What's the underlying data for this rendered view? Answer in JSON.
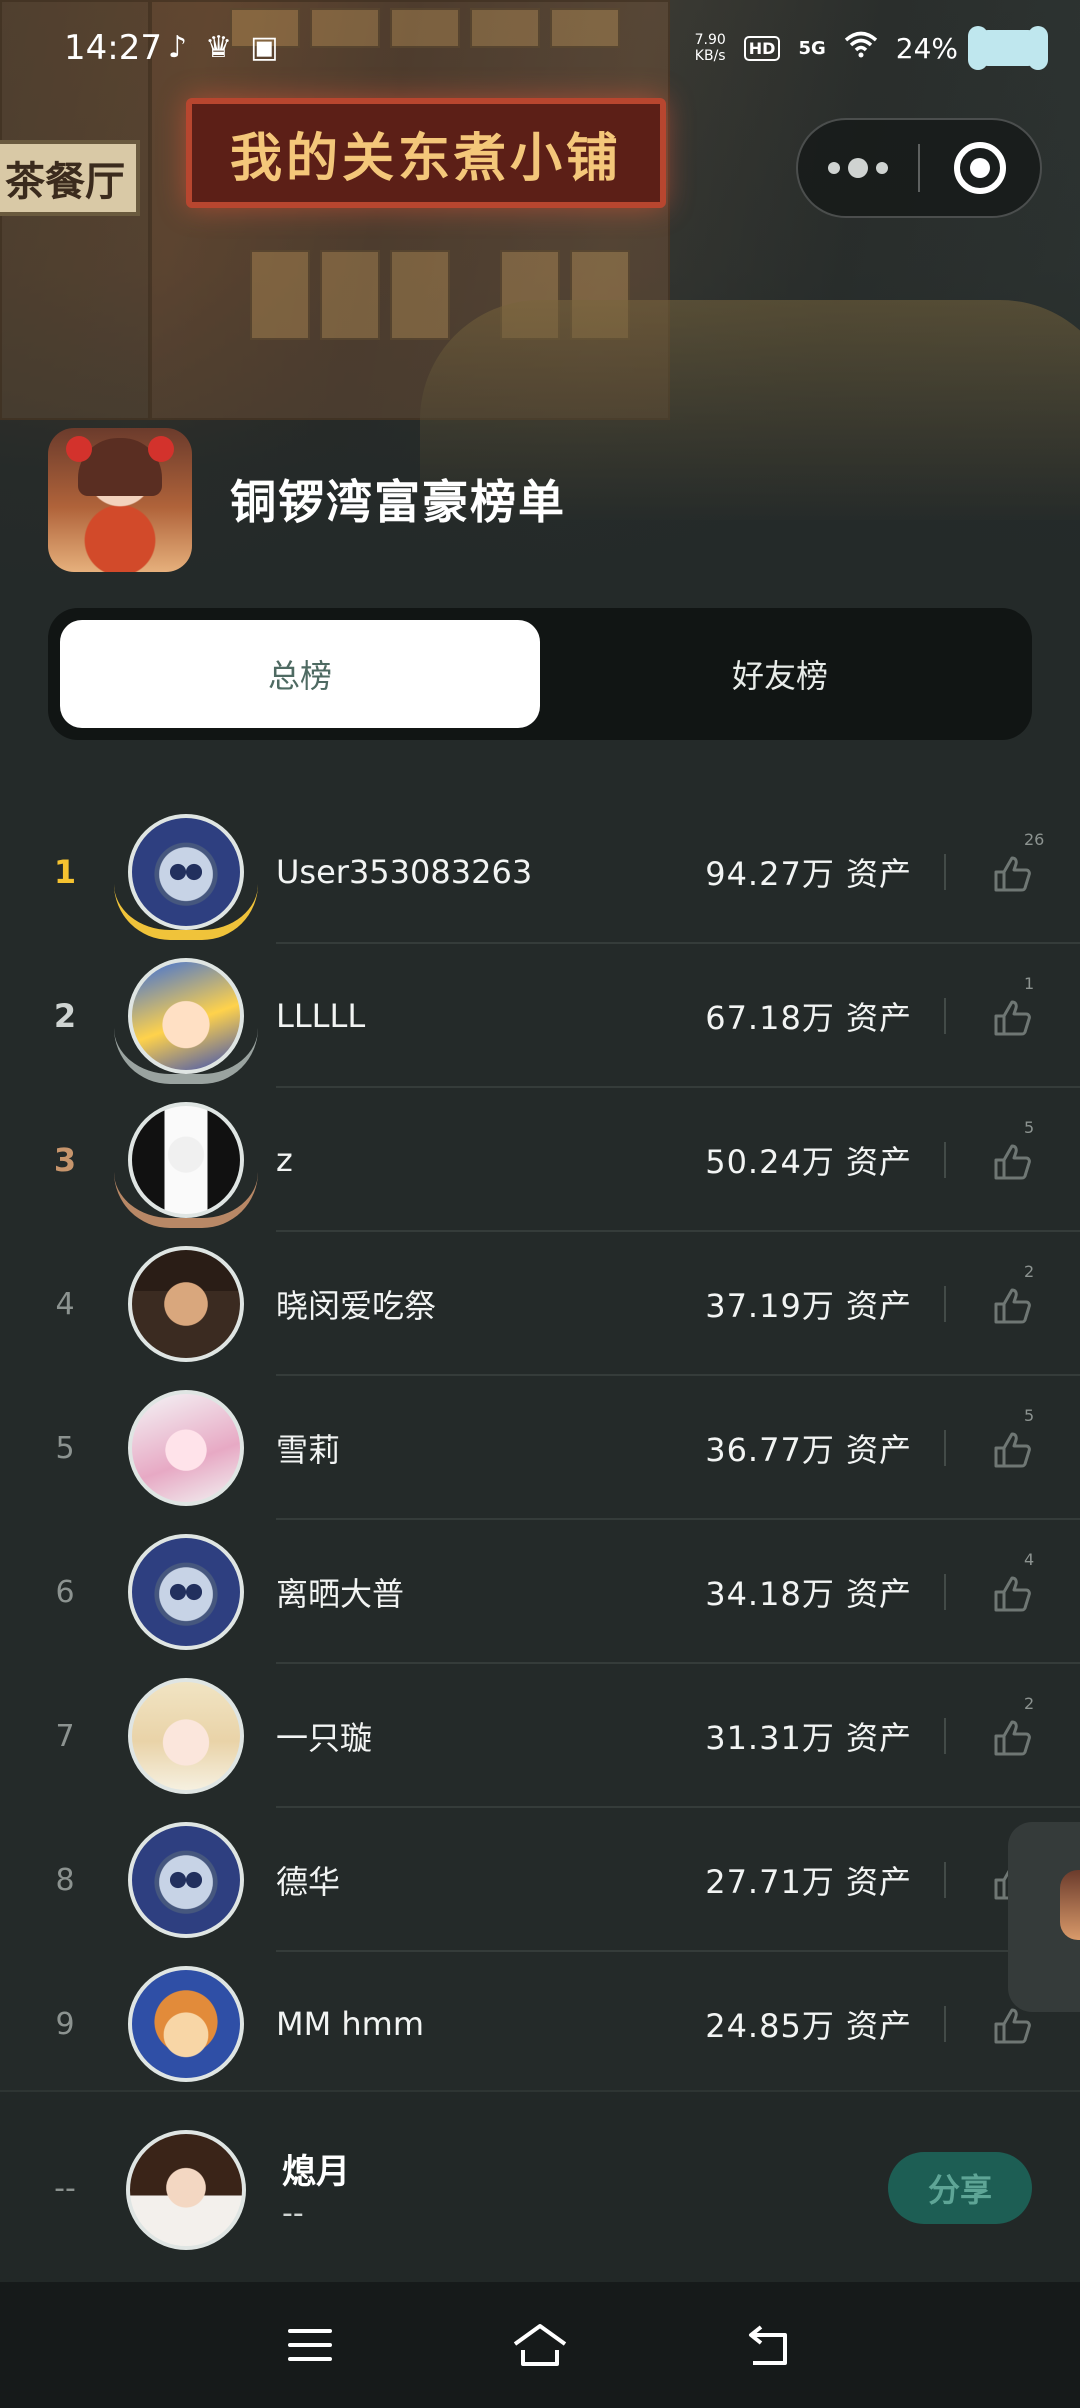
{
  "status_bar": {
    "time": "14:27",
    "net_speed_value": "7.90",
    "net_speed_unit": "KB/s",
    "hd": "HD",
    "network": "5G",
    "battery": "24%"
  },
  "hero": {
    "shop_sign": "我的关东煮小铺",
    "left_sign": "茶餐厅"
  },
  "header": {
    "title": "铜锣湾富豪榜单"
  },
  "tabs": [
    {
      "label": "总榜",
      "active": true
    },
    {
      "label": "好友榜",
      "active": false
    }
  ],
  "leaderboard": [
    {
      "rank": "1",
      "name": "User353083263",
      "assets": "94.27万 资产",
      "likes": "26"
    },
    {
      "rank": "2",
      "name": "LLLLL",
      "assets": "67.18万 资产",
      "likes": "1"
    },
    {
      "rank": "3",
      "name": "z",
      "assets": "50.24万 资产",
      "likes": "5"
    },
    {
      "rank": "4",
      "name": "晓闵爱吃祭",
      "assets": "37.19万 资产",
      "likes": "2"
    },
    {
      "rank": "5",
      "name": "雪莉",
      "assets": "36.77万 资产",
      "likes": "5"
    },
    {
      "rank": "6",
      "name": "离晒大普",
      "assets": "34.18万 资产",
      "likes": "4"
    },
    {
      "rank": "7",
      "name": "一只璇",
      "assets": "31.31万 资产",
      "likes": "2"
    },
    {
      "rank": "8",
      "name": "德华",
      "assets": "27.71万 资产",
      "likes": ""
    },
    {
      "rank": "9",
      "name": "MM hmm",
      "assets": "24.85万 资产",
      "likes": ""
    }
  ],
  "me": {
    "rank": "--",
    "name": "熄月",
    "assets": "--",
    "share_label": "分享"
  },
  "colors": {
    "background": "#242a29",
    "gold": "#f5c230",
    "silver": "#cfd4d2",
    "bronze": "#c7956c",
    "share_button": "#1d5e54"
  }
}
